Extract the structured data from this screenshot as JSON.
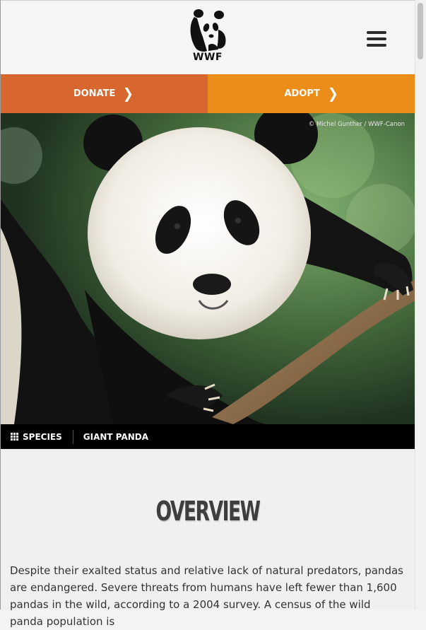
{
  "header": {
    "logo_text": "WWF",
    "menu_icon": "hamburger-menu-icon"
  },
  "cta": {
    "donate_label": "DONATE",
    "adopt_label": "ADOPT",
    "chevron_icon": "chevron-right-icon",
    "donate_color": "#d8672f",
    "adopt_color": "#ec8d1a"
  },
  "hero": {
    "credit": "© Michel Gunther / WWF-Canon"
  },
  "breadcrumb": {
    "species_label": "SPECIES",
    "species_icon": "grid-icon",
    "current_label": "GIANT PANDA"
  },
  "overview": {
    "title": "OVERVIEW",
    "text": "Despite their exalted status and relative lack of natural predators, pandas are endangered. Severe threats from humans have left fewer than 1,600 pandas in the wild, according to a 2004 survey. A census of the wild panda population is"
  }
}
